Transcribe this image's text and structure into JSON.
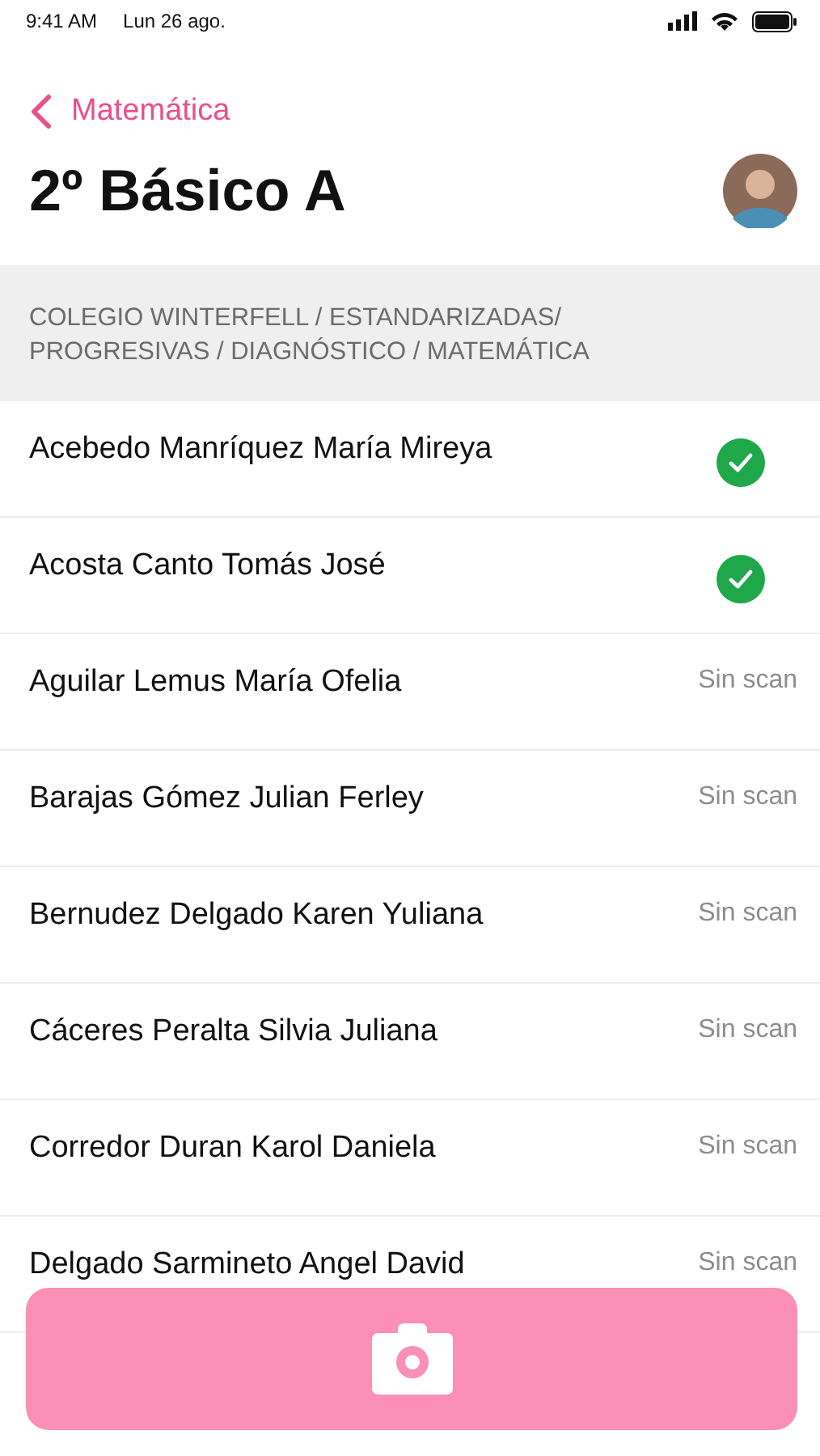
{
  "status_bar": {
    "time": "9:41 AM",
    "date": "Lun 26 ago."
  },
  "nav": {
    "back_label": "Matemática",
    "title": "2º Básico A"
  },
  "breadcrumb": "COLEGIO WINTERFELL / ESTANDARIZADAS/ PROGRESIVAS / DIAGNÓSTICO / MATEMÁTICA",
  "students": [
    {
      "name": "Acebedo Manríquez María Mireya",
      "scanned": true
    },
    {
      "name": "Acosta Canto Tomás José",
      "scanned": true
    },
    {
      "name": "Aguilar Lemus María Ofelia",
      "scanned": false,
      "status": "Sin scan"
    },
    {
      "name": "Barajas Gómez Julian Ferley",
      "scanned": false,
      "status": "Sin scan"
    },
    {
      "name": "Bernudez Delgado Karen Yuliana",
      "scanned": false,
      "status": "Sin scan"
    },
    {
      "name": "Cáceres Peralta Silvia Juliana",
      "scanned": false,
      "status": "Sin scan"
    },
    {
      "name": "Corredor Duran Karol Daniela",
      "scanned": false,
      "status": "Sin scan"
    },
    {
      "name": "Delgado Sarmineto Angel David",
      "scanned": false,
      "status": "Sin scan"
    }
  ]
}
